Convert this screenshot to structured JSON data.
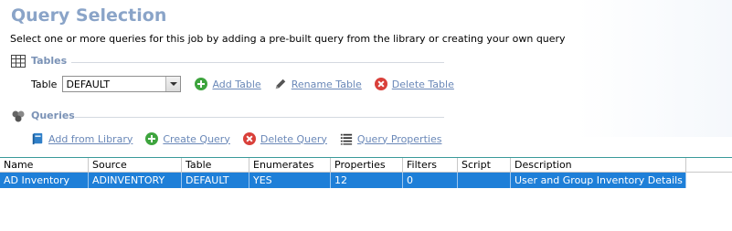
{
  "page": {
    "title": "Query Selection",
    "subtitle": "Select one or more queries for this job by adding a pre-built query from the library or creating your own query"
  },
  "tables_section": {
    "heading": "Tables",
    "table_label": "Table",
    "table_value": "DEFAULT",
    "actions": {
      "add": "Add Table",
      "rename": "Rename Table",
      "delete": "Delete Table"
    }
  },
  "queries_section": {
    "heading": "Queries",
    "actions": {
      "add_from_library": "Add from Library",
      "create": "Create Query",
      "delete": "Delete Query",
      "properties": "Query Properties"
    }
  },
  "grid": {
    "columns": [
      "Name",
      "Source",
      "Table",
      "Enumerates",
      "Properties",
      "Filters",
      "Script",
      "Description"
    ],
    "rows": [
      [
        "AD Inventory",
        "ADINVENTORY",
        "DEFAULT",
        "YES",
        "12",
        "0",
        "",
        "User and Group Inventory Details"
      ]
    ]
  },
  "colors": {
    "title": "#8aa4c8",
    "section_heading": "#7a92b6",
    "link": "#6a88b8",
    "selection": "#1e7fd8"
  }
}
